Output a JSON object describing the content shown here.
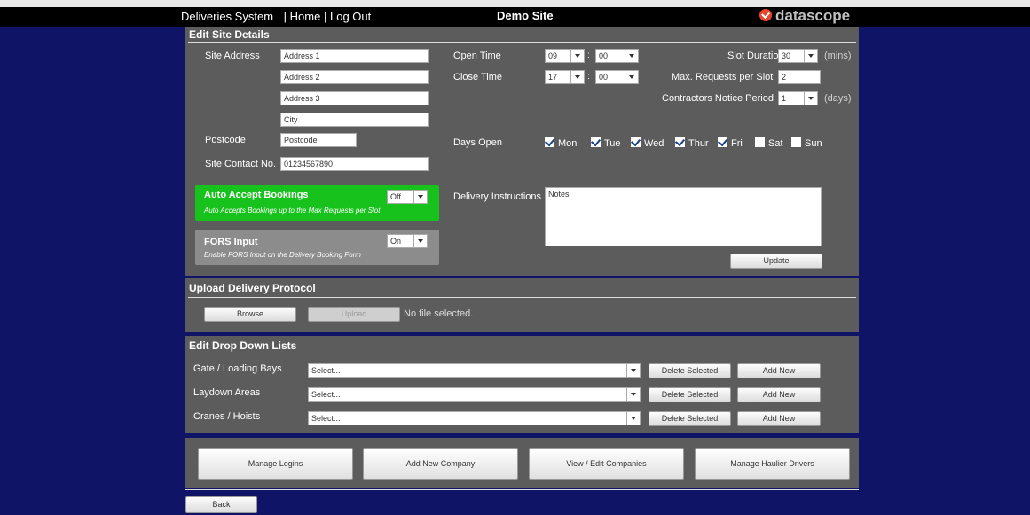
{
  "header": {
    "nav_title": "Deliveries System",
    "sep1": "|",
    "home": "Home",
    "sep2": "|",
    "logout": "Log Out",
    "site_name": "Demo Site",
    "logo": "datascope"
  },
  "site": {
    "title": "Edit Site Details",
    "address_label": "Site Address",
    "address1": "Address 1",
    "address2": "Address 2",
    "address3": "Address 3",
    "city": "City",
    "postcode_label": "Postcode",
    "postcode": "Postcode",
    "contact_label": "Site Contact No.",
    "contact": "01234567890",
    "open_time_label": "Open Time",
    "open_hour": "09",
    "open_colon": ":",
    "open_min": "00",
    "close_time_label": "Close Time",
    "close_hour": "17",
    "close_colon": ":",
    "close_min": "00",
    "slot_duration_label": "Slot Duration",
    "slot_duration": "30",
    "slot_unit": "(mins)",
    "max_requests_label": "Max. Requests per Slot",
    "max_requests": "2",
    "notice_label": "Contractors Notice Period",
    "notice": "1",
    "notice_unit": "(days)",
    "days_label": "Days Open",
    "days": [
      {
        "label": "Mon",
        "checked": true
      },
      {
        "label": "Tue",
        "checked": true
      },
      {
        "label": "Wed",
        "checked": true
      },
      {
        "label": "Thur",
        "checked": true
      },
      {
        "label": "Fri",
        "checked": true
      },
      {
        "label": "Sat",
        "checked": false
      },
      {
        "label": "Sun",
        "checked": false
      }
    ],
    "auto_accept_title": "Auto Accept Bookings",
    "auto_accept_value": "Off",
    "auto_accept_sub": "Auto Accepts Bookings up to the Max Requests per Slot",
    "auto_accept_color": "#18c21c",
    "fors_title": "FORS Input",
    "fors_value": "On",
    "fors_sub": "Enable FORS Input on the Delivery Booking Form",
    "delivery_instr_label": "Delivery Instructions",
    "notes": "Notes",
    "update": "Update"
  },
  "upload": {
    "title": "Upload Delivery Protocol",
    "browse": "Browse",
    "upload": "Upload",
    "status": "No file selected."
  },
  "dropdowns": {
    "title": "Edit Drop Down Lists",
    "rows": [
      {
        "label": "Gate / Loading Bays",
        "value": "Select...",
        "delete": "Delete Selected",
        "add": "Add New"
      },
      {
        "label": "Laydown Areas",
        "value": "Select...",
        "delete": "Delete Selected",
        "add": "Add New"
      },
      {
        "label": "Cranes / Hoists",
        "value": "Select...",
        "delete": "Delete Selected",
        "add": "Add New"
      }
    ]
  },
  "actions": {
    "manage_logins": "Manage Logins",
    "add_company": "Add New Company",
    "view_companies": "View / Edit Companies",
    "manage_drivers": "Manage Haulier Drivers"
  },
  "back": "Back",
  "colors": {
    "background": "#0f1466",
    "panel": "#5c5c5c"
  }
}
